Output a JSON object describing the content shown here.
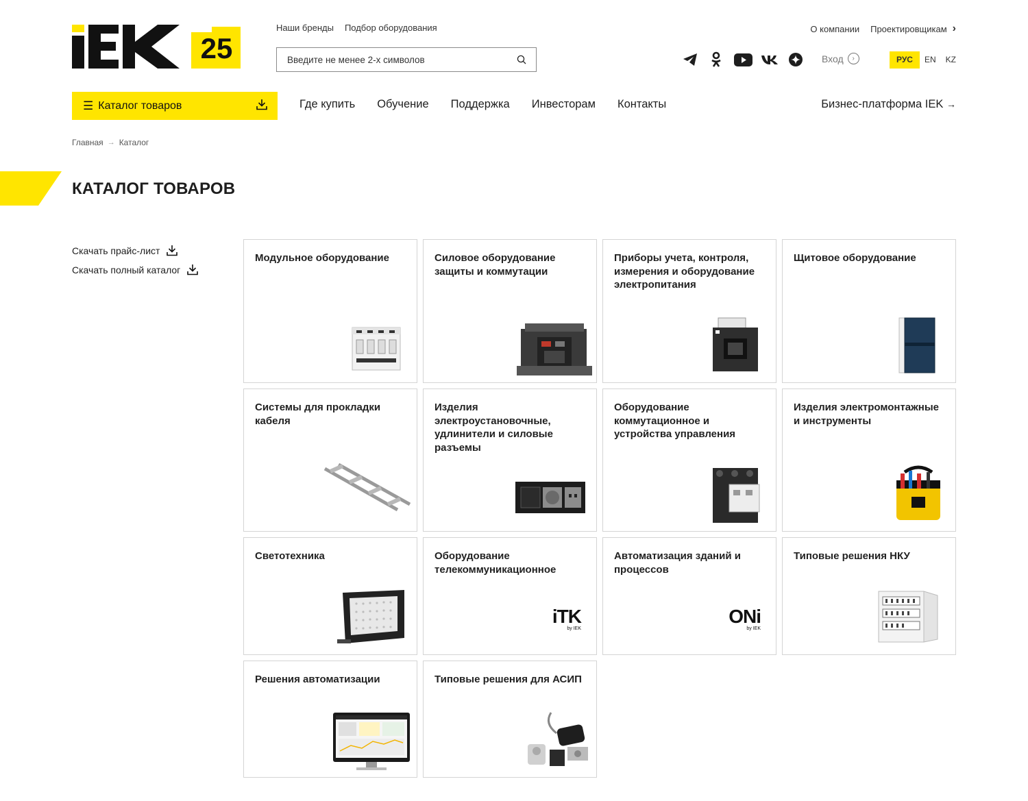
{
  "header": {
    "top_links": [
      "Наши бренды",
      "Подбор оборудования"
    ],
    "right_links": [
      "О компании",
      "Проектировщикам"
    ],
    "search_placeholder": "Введите не менее 2-х символов",
    "login_label": "Вход",
    "languages": [
      {
        "label": "РУС",
        "active": true
      },
      {
        "label": "EN",
        "active": false
      },
      {
        "label": "KZ",
        "active": false
      }
    ],
    "socials": [
      "telegram-icon",
      "odnoklassniki-icon",
      "youtube-icon",
      "vk-icon",
      "dzen-icon"
    ]
  },
  "logo": {
    "text": "IEK",
    "badge": "25"
  },
  "nav": {
    "catalog_label": "Каталог товаров",
    "items": [
      "Где купить",
      "Обучение",
      "Поддержка",
      "Инвесторам",
      "Контакты"
    ],
    "business_label": "Бизнес-платформа IEK"
  },
  "breadcrumb": [
    "Главная",
    "Каталог"
  ],
  "page_title": "КАТАЛОГ ТОВАРОВ",
  "side_links": [
    "Скачать прайс-лист",
    "Скачать полный каталог"
  ],
  "categories": [
    {
      "title": "Модульное оборудование",
      "icon": "circuit-breaker-icon"
    },
    {
      "title": "Силовое оборудование защиты и коммутации",
      "icon": "air-circuit-breaker-icon"
    },
    {
      "title": "Приборы учета, контроля, измерения и оборудование электропитания",
      "icon": "current-transformer-icon"
    },
    {
      "title": "Щитовое оборудование",
      "icon": "distribution-box-icon"
    },
    {
      "title": "Системы для прокладки кабеля",
      "icon": "cable-ladder-icon"
    },
    {
      "title": "Изделия электроустановочные, удлинители и силовые разъемы",
      "icon": "socket-frame-icon"
    },
    {
      "title": "Оборудование коммутационное и устройства управления",
      "icon": "contactor-icon"
    },
    {
      "title": "Изделия электромонтажные и инструменты",
      "icon": "tool-bag-icon"
    },
    {
      "title": "Светотехника",
      "icon": "floodlight-icon"
    },
    {
      "title": "Оборудование телекоммуникационное",
      "icon": "itk-logo-icon",
      "logo_text": "iTK",
      "logo_sub": "by IEK"
    },
    {
      "title": "Автоматизация зданий и процессов",
      "icon": "oni-logo-icon",
      "logo_text": "ONi",
      "logo_sub": "by IEK"
    },
    {
      "title": "Типовые решения НКУ",
      "icon": "electrical-cabinet-icon"
    },
    {
      "title": "Решения автоматизации",
      "icon": "monitor-dashboard-icon"
    },
    {
      "title": "Типовые решения для АСИП",
      "icon": "clamps-icon"
    }
  ],
  "colors": {
    "accent": "#ffe500",
    "text": "#1e1e1e",
    "border": "#d4d4d4"
  }
}
